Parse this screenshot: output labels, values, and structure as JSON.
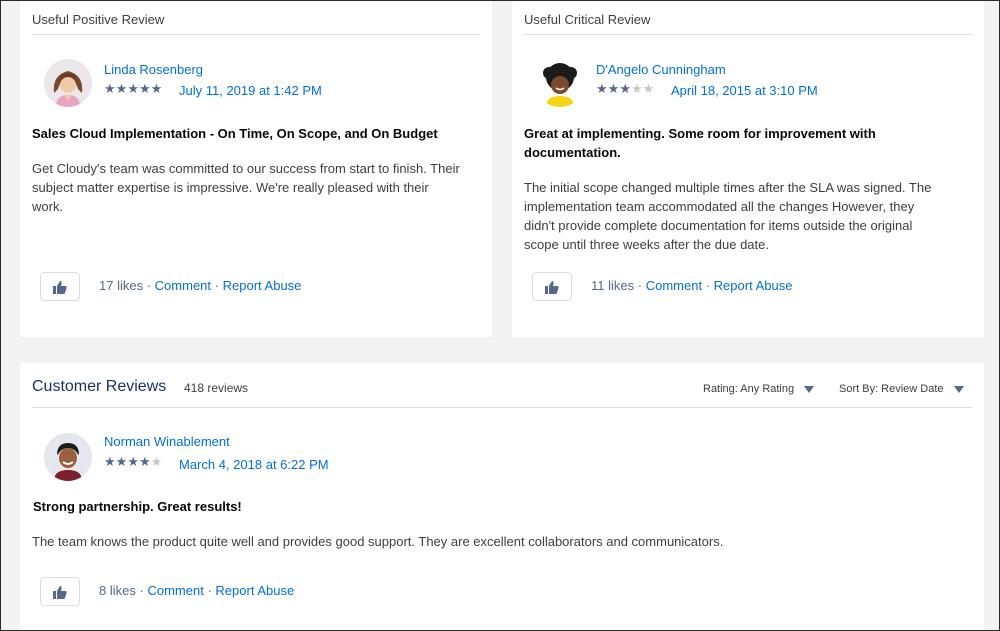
{
  "positive": {
    "header": "Useful Positive Review",
    "author": "Linda Rosenberg",
    "rating": 5,
    "date": "July 11, 2019 at 1:42 PM",
    "title": "Sales Cloud Implementation - On Time, On Scope, and On Budget",
    "body_lines": [
      "Get Cloudy's team was committed to our success from start to finish. Their",
      "subject matter expertise is impressive. We're really pleased with their",
      "work."
    ],
    "likes": "17 likes",
    "comment": "Comment",
    "report": "Report Abuse"
  },
  "critical": {
    "header": "Useful Critical Review",
    "author": "D'Angelo Cunningham",
    "rating": 3,
    "date": "April 18, 2015 at 3:10 PM",
    "title_lines": [
      "Great at implementing. Some room for improvement with",
      "documentation."
    ],
    "body_lines": [
      "The initial scope changed multiple times after the SLA was signed. The",
      "implementation team accommodated all the changes However, they",
      "didn't provide complete documentation for items outside the original",
      "scope until three weeks after the due date."
    ],
    "likes": "11 likes",
    "comment": "Comment",
    "report": "Report Abuse"
  },
  "customer_reviews": {
    "title": "Customer Reviews",
    "count": "418 reviews",
    "rating_filter": "Rating: Any Rating",
    "sort_filter": "Sort By: Review Date",
    "review": {
      "author": "Norman Winablement",
      "rating": 4,
      "date": "March 4, 2018 at 6:22 PM",
      "title": "Strong partnership. Great results!",
      "body": "The team knows the product quite well and provides good support. They are excellent collaborators and communicators.",
      "likes": "8 likes",
      "comment": "Comment",
      "report": "Report Abuse"
    }
  },
  "icons": {
    "star_filled": "★",
    "star_empty": "★",
    "separator": "·"
  },
  "colors": {
    "link": "#0070d2",
    "star_on": "#54698d",
    "star_off": "#c9c7c5",
    "background": "#f3f3f4"
  }
}
